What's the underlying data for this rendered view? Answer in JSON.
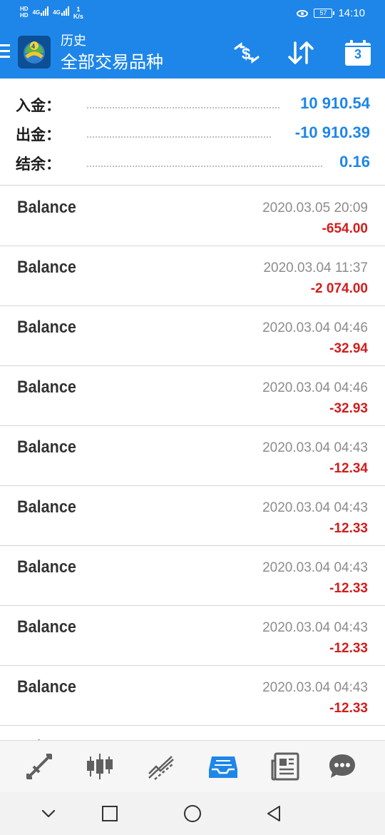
{
  "status_bar": {
    "left_badges": [
      "HD",
      "HD"
    ],
    "network_1": "4G",
    "network_2": "4G",
    "speed_value": "1",
    "speed_unit": "K/s",
    "battery": "57",
    "time": "14:10"
  },
  "app_bar": {
    "title": "历史",
    "subtitle": "全部交易品种",
    "calendar_day": "3"
  },
  "summary": {
    "deposit_label": "入金：",
    "deposit_value": "10 910.54",
    "withdrawal_label": "出金：",
    "withdrawal_value": "-10 910.39",
    "balance_label": "结余：",
    "balance_value": "0.16",
    "value_color": "#1e86e8"
  },
  "history": {
    "rows": [
      {
        "type": "Balance",
        "time": "2020.03.05 20:09",
        "amount": "-654.00"
      },
      {
        "type": "Balance",
        "time": "2020.03.04 11:37",
        "amount": "-2 074.00"
      },
      {
        "type": "Balance",
        "time": "2020.03.04 04:46",
        "amount": "-32.94"
      },
      {
        "type": "Balance",
        "time": "2020.03.04 04:46",
        "amount": "-32.93"
      },
      {
        "type": "Balance",
        "time": "2020.03.04 04:43",
        "amount": "-12.34"
      },
      {
        "type": "Balance",
        "time": "2020.03.04 04:43",
        "amount": "-12.33"
      },
      {
        "type": "Balance",
        "time": "2020.03.04 04:43",
        "amount": "-12.33"
      },
      {
        "type": "Balance",
        "time": "2020.03.04 04:43",
        "amount": "-12.33"
      },
      {
        "type": "Balance",
        "time": "2020.03.04 04:43",
        "amount": "-12.33"
      },
      {
        "type": "Balance",
        "time": "",
        "amount": ""
      }
    ],
    "negative_color": "#d21d1d"
  },
  "bottom_tabs": {
    "items": [
      {
        "icon": "quotes-arrows-icon",
        "active": false
      },
      {
        "icon": "candlestick-chart-icon",
        "active": false
      },
      {
        "icon": "trade-trend-icon",
        "active": false
      },
      {
        "icon": "history-inbox-icon",
        "active": true
      },
      {
        "icon": "news-icon",
        "active": false
      },
      {
        "icon": "chat-icon",
        "active": false
      }
    ],
    "active_color": "#1e86e8",
    "inactive_color": "#5f5f5f"
  },
  "system_nav": {
    "icons": [
      "hide-keyboard-icon",
      "recents-icon",
      "home-icon",
      "back-icon"
    ]
  }
}
